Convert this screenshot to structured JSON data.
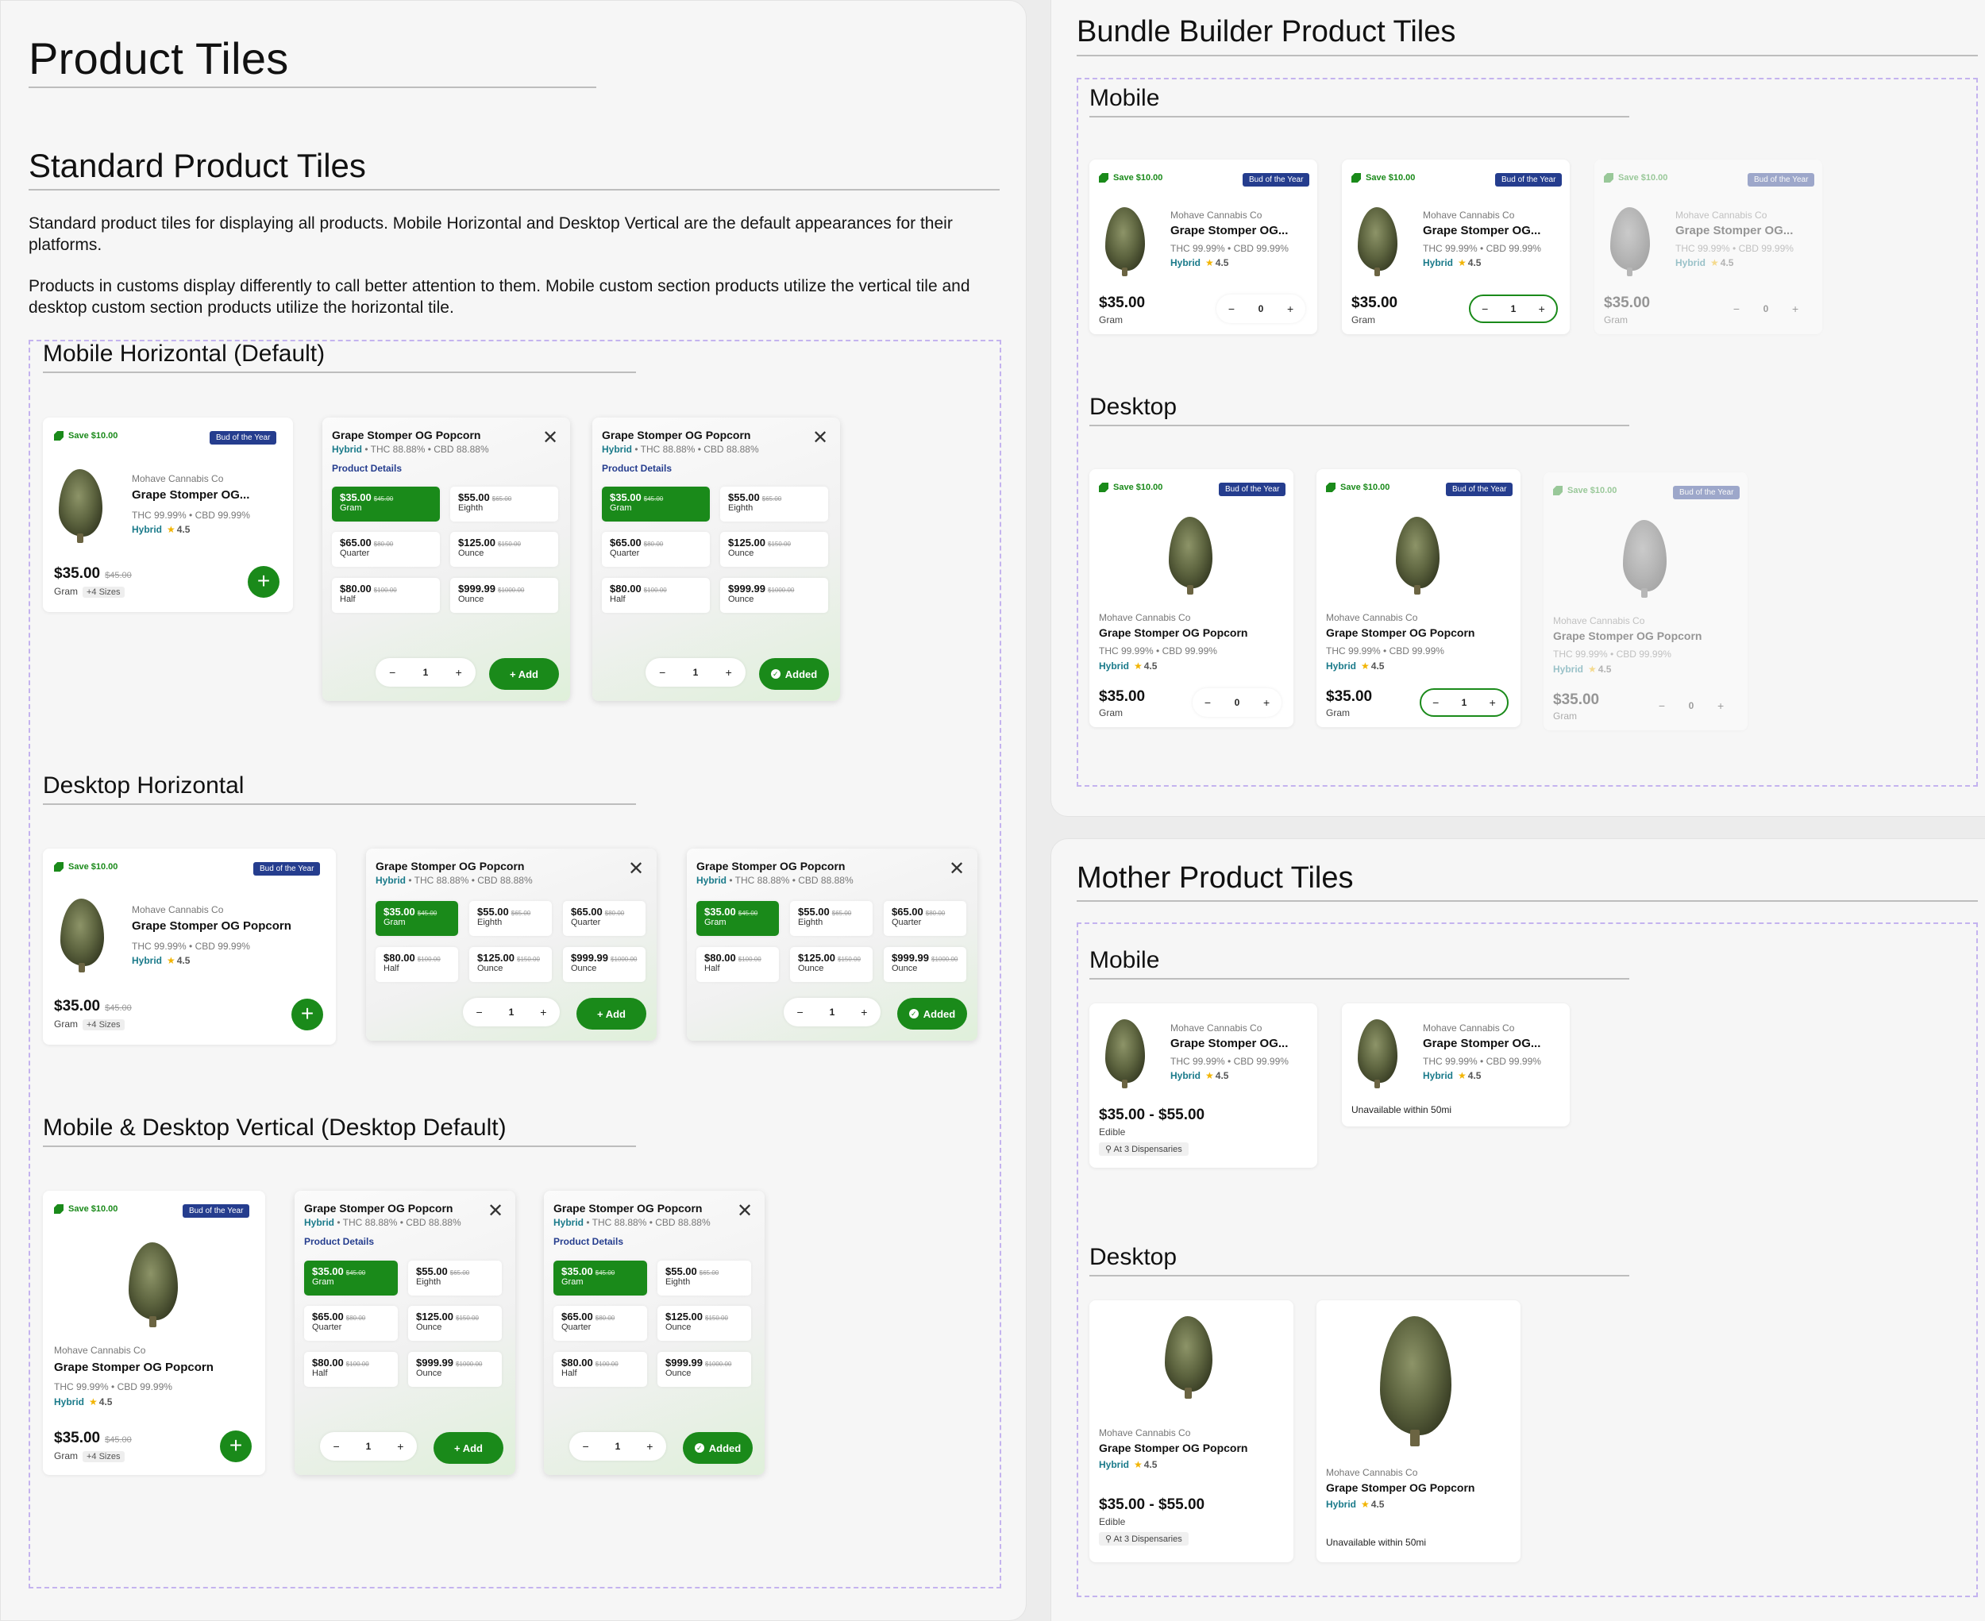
{
  "left": {
    "title": "Product Tiles",
    "standard_title": "Standard Product Tiles",
    "para1": "Standard product tiles for displaying all products. Mobile Horizontal and Desktop Vertical are the default appearances for their platforms.",
    "para2": "Products in customs display differently to call better attention to them. Mobile custom section products utilize the vertical tile and desktop custom section products utilize the horizontal tile.",
    "sec_mobile_h": "Mobile Horizontal (Default)",
    "sec_desktop_h": "Desktop Horizontal",
    "sec_vertical": "Mobile & Desktop Vertical (Desktop Default)"
  },
  "bundle": {
    "title": "Bundle Builder Product Tiles",
    "mobile": "Mobile",
    "desktop": "Desktop"
  },
  "mother": {
    "title": "Mother Product Tiles",
    "mobile": "Mobile",
    "desktop": "Desktop"
  },
  "product": {
    "save": "Save $10.00",
    "badge": "Bud of the Year",
    "brand": "Mohave Cannabis Co",
    "name_short": "Grape Stomper OG...",
    "name_full": "Grape Stomper OG Popcorn",
    "potency": "THC 99.99% • CBD 99.99%",
    "strain": "Hybrid",
    "rating": "4.5",
    "star": "★",
    "price": "$35.00",
    "old_price": "$45.00",
    "unit": "Gram",
    "sizes": "+4 Sizes",
    "plus": "+",
    "range": "$35.00 - $55.00",
    "edible": "Edible",
    "dispensaries": "At 3 Dispensaries",
    "unavailable": "Unavailable within 50mi",
    "pin": "⚲"
  },
  "popup": {
    "title": "Grape Stomper OG Popcorn",
    "strain": "Hybrid",
    "potency": "• THC 88.88% • CBD 88.88%",
    "details": "Product Details",
    "close": "✕",
    "options": [
      {
        "price": "$35.00",
        "old": "$45.00",
        "unit": "Gram"
      },
      {
        "price": "$55.00",
        "old": "$65.00",
        "unit": "Eighth"
      },
      {
        "price": "$65.00",
        "old": "$80.00",
        "unit": "Quarter"
      },
      {
        "price": "$125.00",
        "old": "$150.00",
        "unit": "Ounce"
      },
      {
        "price": "$80.00",
        "old": "$100.00",
        "unit": "Half"
      },
      {
        "price": "$999.99",
        "old": "$1000.00",
        "unit": "Ounce"
      }
    ],
    "minus": "−",
    "plus": "+",
    "qty": "1",
    "add": "+ Add",
    "added": "Added",
    "check": "✓"
  },
  "steppers": {
    "minus": "−",
    "plus": "+",
    "zero": "0",
    "one": "1"
  }
}
